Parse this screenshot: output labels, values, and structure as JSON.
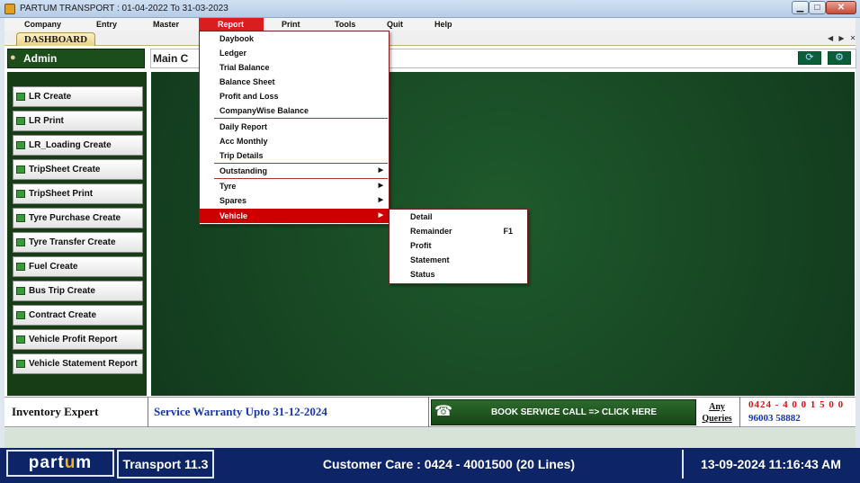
{
  "window": {
    "title": "PARTUM  TRANSPORT : 01-04-2022 To 31-03-2023",
    "minimize_icon": "minimize-icon",
    "maximize_icon": "maximize-icon",
    "close_icon": "close-icon",
    "min_glyph": "▁",
    "max_glyph": "□",
    "close_glyph": "✕"
  },
  "menubar": {
    "items": [
      "Company",
      "Entry",
      "Master",
      "Report",
      "Print",
      "Tools",
      "Quit",
      "Help"
    ],
    "active": "Report"
  },
  "tabs": {
    "active_label": "DASHBOARD",
    "nav_arrows": "◀ ▶ ✕"
  },
  "admin_panel": {
    "title": "Admin",
    "icon": "user-icon",
    "buttons": [
      "LR Create",
      "LR Print",
      "LR_Loading Create",
      "TripSheet Create",
      "TripSheet Print",
      "Tyre Purchase Create",
      "Tyre Transfer Create",
      "Fuel Create",
      "Bus Trip Create",
      "Contract Create",
      "Vehicle  Profit Report",
      "Vehicle  Statement Report"
    ]
  },
  "main_panel": {
    "title": "Main C",
    "refresh_icon": "refresh-icon",
    "settings_icon": "gear-icon",
    "refresh_glyph": "⟳",
    "settings_glyph": "⚙"
  },
  "report_menu": {
    "items": [
      {
        "label": "Daybook",
        "submenu": false
      },
      {
        "label": "Ledger",
        "submenu": false
      },
      {
        "label": "Trial Balance",
        "submenu": false
      },
      {
        "label": "Balance Sheet",
        "submenu": false
      },
      {
        "label": "Profit and Loss",
        "submenu": false
      },
      {
        "label": "CompanyWise Balance",
        "submenu": false
      },
      {
        "label": "Daily Report",
        "submenu": false
      },
      {
        "label": "Acc Monthly",
        "submenu": false
      },
      {
        "label": "Trip Details",
        "submenu": false
      },
      {
        "label": "Outstanding",
        "submenu": true
      },
      {
        "label": "Tyre",
        "submenu": true
      },
      {
        "label": "Spares",
        "submenu": true
      },
      {
        "label": "Vehicle",
        "submenu": true
      }
    ],
    "highlighted": "Vehicle",
    "submenu_arrow": "▶"
  },
  "vehicle_submenu": {
    "items": [
      {
        "label": "Detail",
        "shortcut": ""
      },
      {
        "label": "Remainder",
        "shortcut": "F1"
      },
      {
        "label": "Profit",
        "shortcut": ""
      },
      {
        "label": "Statement",
        "shortcut": ""
      },
      {
        "label": "Status",
        "shortcut": ""
      }
    ]
  },
  "footer": {
    "product": "Inventory Expert",
    "warranty": "Service Warranty Upto 31-12-2024",
    "book_service": "BOOK SERVICE CALL => CLICK HERE",
    "book_icon": "support-agent-icon",
    "book_glyph": "☎",
    "queries_line1": "Any",
    "queries_line2": "Queries",
    "phone1": "0424 - 4 0 0 1 5 0 0",
    "phone2": "96003 58882"
  },
  "statusbar": {
    "logo_pre": "part",
    "logo_mid": "u",
    "logo_post": "m",
    "version": "Transport 11.3",
    "customer_care": "Customer Care : 0424 - 4001500  (20 Lines)",
    "datetime": "13-09-2024 11:16:43 AM"
  },
  "colors": {
    "menu_active": "#d81e1e",
    "panel_green": "#173d17",
    "statusbar_navy": "#0d2466",
    "warranty_blue": "#1638a8",
    "phone_red": "#d11"
  }
}
